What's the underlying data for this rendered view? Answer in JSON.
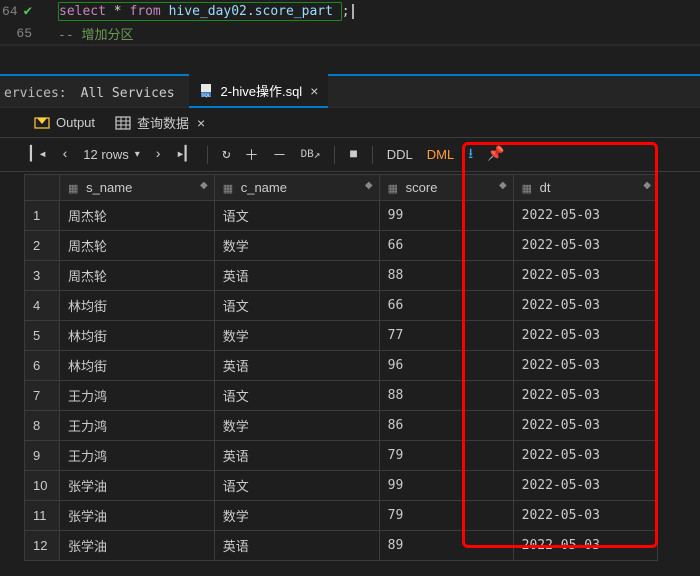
{
  "editor": {
    "line64_num": "64",
    "line65_num": "65",
    "sql_select": "select",
    "sql_star": "*",
    "sql_from": "from",
    "sql_ident": "hive_day02.score_part",
    "sql_semi": ";",
    "comment": "-- 增加分区"
  },
  "services": {
    "label": "ervices:",
    "all": "All Services",
    "file_tab": "2-hive操作.sql"
  },
  "output_tabs": {
    "output": "Output",
    "query_data": "查询数据"
  },
  "toolbar": {
    "rows_label": "12 rows",
    "db_label": "DB",
    "ddl": "DDL",
    "dml": "DML"
  },
  "columns": {
    "s_name": "s_name",
    "c_name": "c_name",
    "score": "score",
    "dt": "dt"
  },
  "rows": [
    {
      "n": "1",
      "s_name": "周杰轮",
      "c_name": "语文",
      "score": "99",
      "dt": "2022-05-03"
    },
    {
      "n": "2",
      "s_name": "周杰轮",
      "c_name": "数学",
      "score": "66",
      "dt": "2022-05-03"
    },
    {
      "n": "3",
      "s_name": "周杰轮",
      "c_name": "英语",
      "score": "88",
      "dt": "2022-05-03"
    },
    {
      "n": "4",
      "s_name": "林均街",
      "c_name": "语文",
      "score": "66",
      "dt": "2022-05-03"
    },
    {
      "n": "5",
      "s_name": "林均街",
      "c_name": "数学",
      "score": "77",
      "dt": "2022-05-03"
    },
    {
      "n": "6",
      "s_name": "林均街",
      "c_name": "英语",
      "score": "96",
      "dt": "2022-05-03"
    },
    {
      "n": "7",
      "s_name": "王力鸿",
      "c_name": "语文",
      "score": "88",
      "dt": "2022-05-03"
    },
    {
      "n": "8",
      "s_name": "王力鸿",
      "c_name": "数学",
      "score": "86",
      "dt": "2022-05-03"
    },
    {
      "n": "9",
      "s_name": "王力鸿",
      "c_name": "英语",
      "score": "79",
      "dt": "2022-05-03"
    },
    {
      "n": "10",
      "s_name": "张学油",
      "c_name": "语文",
      "score": "99",
      "dt": "2022-05-03"
    },
    {
      "n": "11",
      "s_name": "张学油",
      "c_name": "数学",
      "score": "79",
      "dt": "2022-05-03"
    },
    {
      "n": "12",
      "s_name": "张学油",
      "c_name": "英语",
      "score": "89",
      "dt": "2022-05-03"
    }
  ],
  "chart_data": {
    "type": "table",
    "columns": [
      "s_name",
      "c_name",
      "score",
      "dt"
    ],
    "rows": [
      [
        "周杰轮",
        "语文",
        99,
        "2022-05-03"
      ],
      [
        "周杰轮",
        "数学",
        66,
        "2022-05-03"
      ],
      [
        "周杰轮",
        "英语",
        88,
        "2022-05-03"
      ],
      [
        "林均街",
        "语文",
        66,
        "2022-05-03"
      ],
      [
        "林均街",
        "数学",
        77,
        "2022-05-03"
      ],
      [
        "林均街",
        "英语",
        96,
        "2022-05-03"
      ],
      [
        "王力鸿",
        "语文",
        88,
        "2022-05-03"
      ],
      [
        "王力鸿",
        "数学",
        86,
        "2022-05-03"
      ],
      [
        "王力鸿",
        "英语",
        79,
        "2022-05-03"
      ],
      [
        "张学油",
        "语文",
        99,
        "2022-05-03"
      ],
      [
        "张学油",
        "数学",
        79,
        "2022-05-03"
      ],
      [
        "张学油",
        "英语",
        89,
        "2022-05-03"
      ]
    ]
  }
}
